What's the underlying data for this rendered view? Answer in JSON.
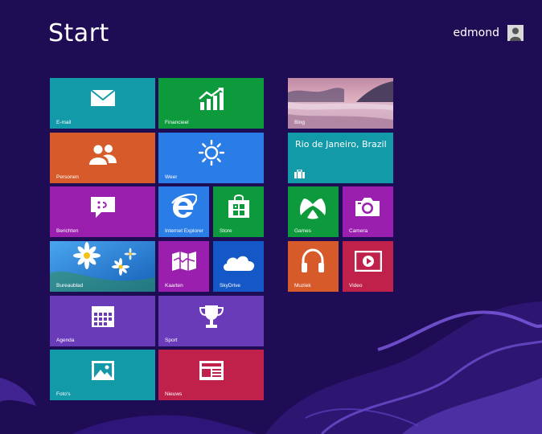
{
  "header": {
    "title": "Start",
    "username": "edmond"
  },
  "colors": {
    "background": "#1e0d55",
    "teal": "#139aa8",
    "green": "#0d9a3c",
    "orange": "#d65a2a",
    "blue": "#2a7ce6",
    "purple": "#9a1fae",
    "violet": "#6a3bb9",
    "red": "#c0214b"
  },
  "tiles": {
    "mail": {
      "label": "E-mail",
      "icon": "envelope-icon"
    },
    "finance": {
      "label": "Financieel",
      "icon": "chart-up-icon"
    },
    "people": {
      "label": "Personen",
      "icon": "people-icon"
    },
    "weather": {
      "label": "Weer",
      "icon": "sun-icon"
    },
    "messaging": {
      "label": "Berichten",
      "icon": "chat-bubble-icon"
    },
    "ie": {
      "label": "Internet Explorer",
      "icon": "ie-logo-icon"
    },
    "store": {
      "label": "Store",
      "icon": "shopping-bag-icon"
    },
    "desktop": {
      "label": "Bureaublad",
      "icon": "daisy-wallpaper"
    },
    "maps": {
      "label": "Kaarten",
      "icon": "folded-map-icon"
    },
    "skydrive": {
      "label": "SkyDrive",
      "icon": "cloud-icon"
    },
    "calendar": {
      "label": "Agenda",
      "icon": "calendar-icon"
    },
    "sport": {
      "label": "Sport",
      "icon": "trophy-icon"
    },
    "photos": {
      "label": "Foto's",
      "icon": "picture-icon"
    },
    "news": {
      "label": "Nieuws",
      "icon": "newspaper-icon"
    },
    "bing": {
      "label": "Bing",
      "icon": "landscape-photo"
    },
    "travel": {
      "label": "",
      "city": "Rio de Janeiro, Brazil",
      "icon": "suitcase-icon"
    },
    "games": {
      "label": "Games",
      "icon": "xbox-icon"
    },
    "camera": {
      "label": "Camera",
      "icon": "camera-icon"
    },
    "music": {
      "label": "Muziek",
      "icon": "headphones-icon"
    },
    "video": {
      "label": "Video",
      "icon": "play-icon"
    }
  }
}
